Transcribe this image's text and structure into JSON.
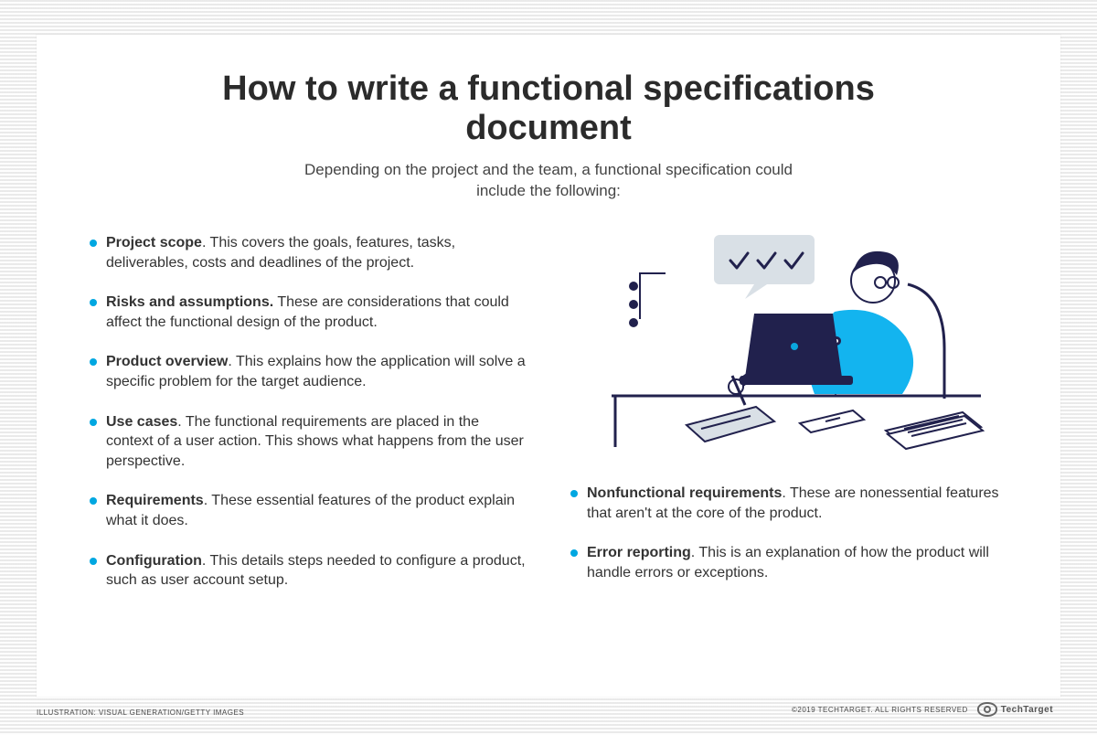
{
  "title": "How to write a functional specifications document",
  "subtitle": "Depending on the project and the team, a functional specification could include the following:",
  "left_items": [
    {
      "term": "Project scope",
      "text": ". This covers the goals, features, tasks, deliverables, costs and deadlines of the project."
    },
    {
      "term": "Risks and assumptions.",
      "text": " These are considerations that could affect the functional design of the product."
    },
    {
      "term": "Product overview",
      "text": ". This explains how the application will solve a specific problem for the target audience."
    },
    {
      "term": "Use cases",
      "text": ". The functional requirements are placed in the context of a user action. This shows what happens from the user perspective."
    },
    {
      "term": "Requirements",
      "text": ". These essential features of the product explain what it does."
    },
    {
      "term": "Configuration",
      "text": ". This details steps needed to configure  a product, such as user account setup."
    }
  ],
  "right_items": [
    {
      "term": "Nonfunctional requirements",
      "text": ". These are nonessential features that aren't at the core of the product."
    },
    {
      "term": "Error reporting",
      "text": ". This is an explanation of how the product will handle errors or exceptions."
    }
  ],
  "credit_left": "ILLUSTRATION: VISUAL GENERATION/GETTY IMAGES",
  "credit_right": "©2019 TECHTARGET. ALL RIGHTS RESERVED",
  "brand": "TechTarget",
  "colors": {
    "accent": "#00a7e1",
    "navy": "#21214d"
  }
}
